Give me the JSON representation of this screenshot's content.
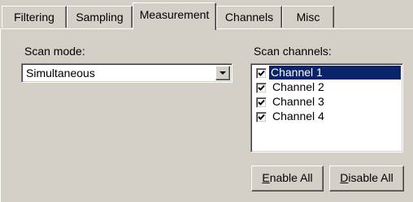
{
  "tabs": [
    {
      "label": "Filtering"
    },
    {
      "label": "Sampling"
    },
    {
      "label": "Measurement",
      "active": true
    },
    {
      "label": "Channels"
    },
    {
      "label": "Misc"
    }
  ],
  "scan_mode": {
    "label": "Scan mode:",
    "value": "Simultaneous"
  },
  "scan_channels": {
    "label": "Scan channels:",
    "items": [
      {
        "label": "Channel 1",
        "checked": true,
        "selected": true
      },
      {
        "label": "Channel 2",
        "checked": true
      },
      {
        "label": "Channel 3",
        "checked": true
      },
      {
        "label": "Channel 4",
        "checked": true
      }
    ]
  },
  "buttons": {
    "enable_all": {
      "accel": "E",
      "rest": "nable All"
    },
    "disable_all": {
      "accel": "D",
      "rest": "isable All"
    }
  }
}
